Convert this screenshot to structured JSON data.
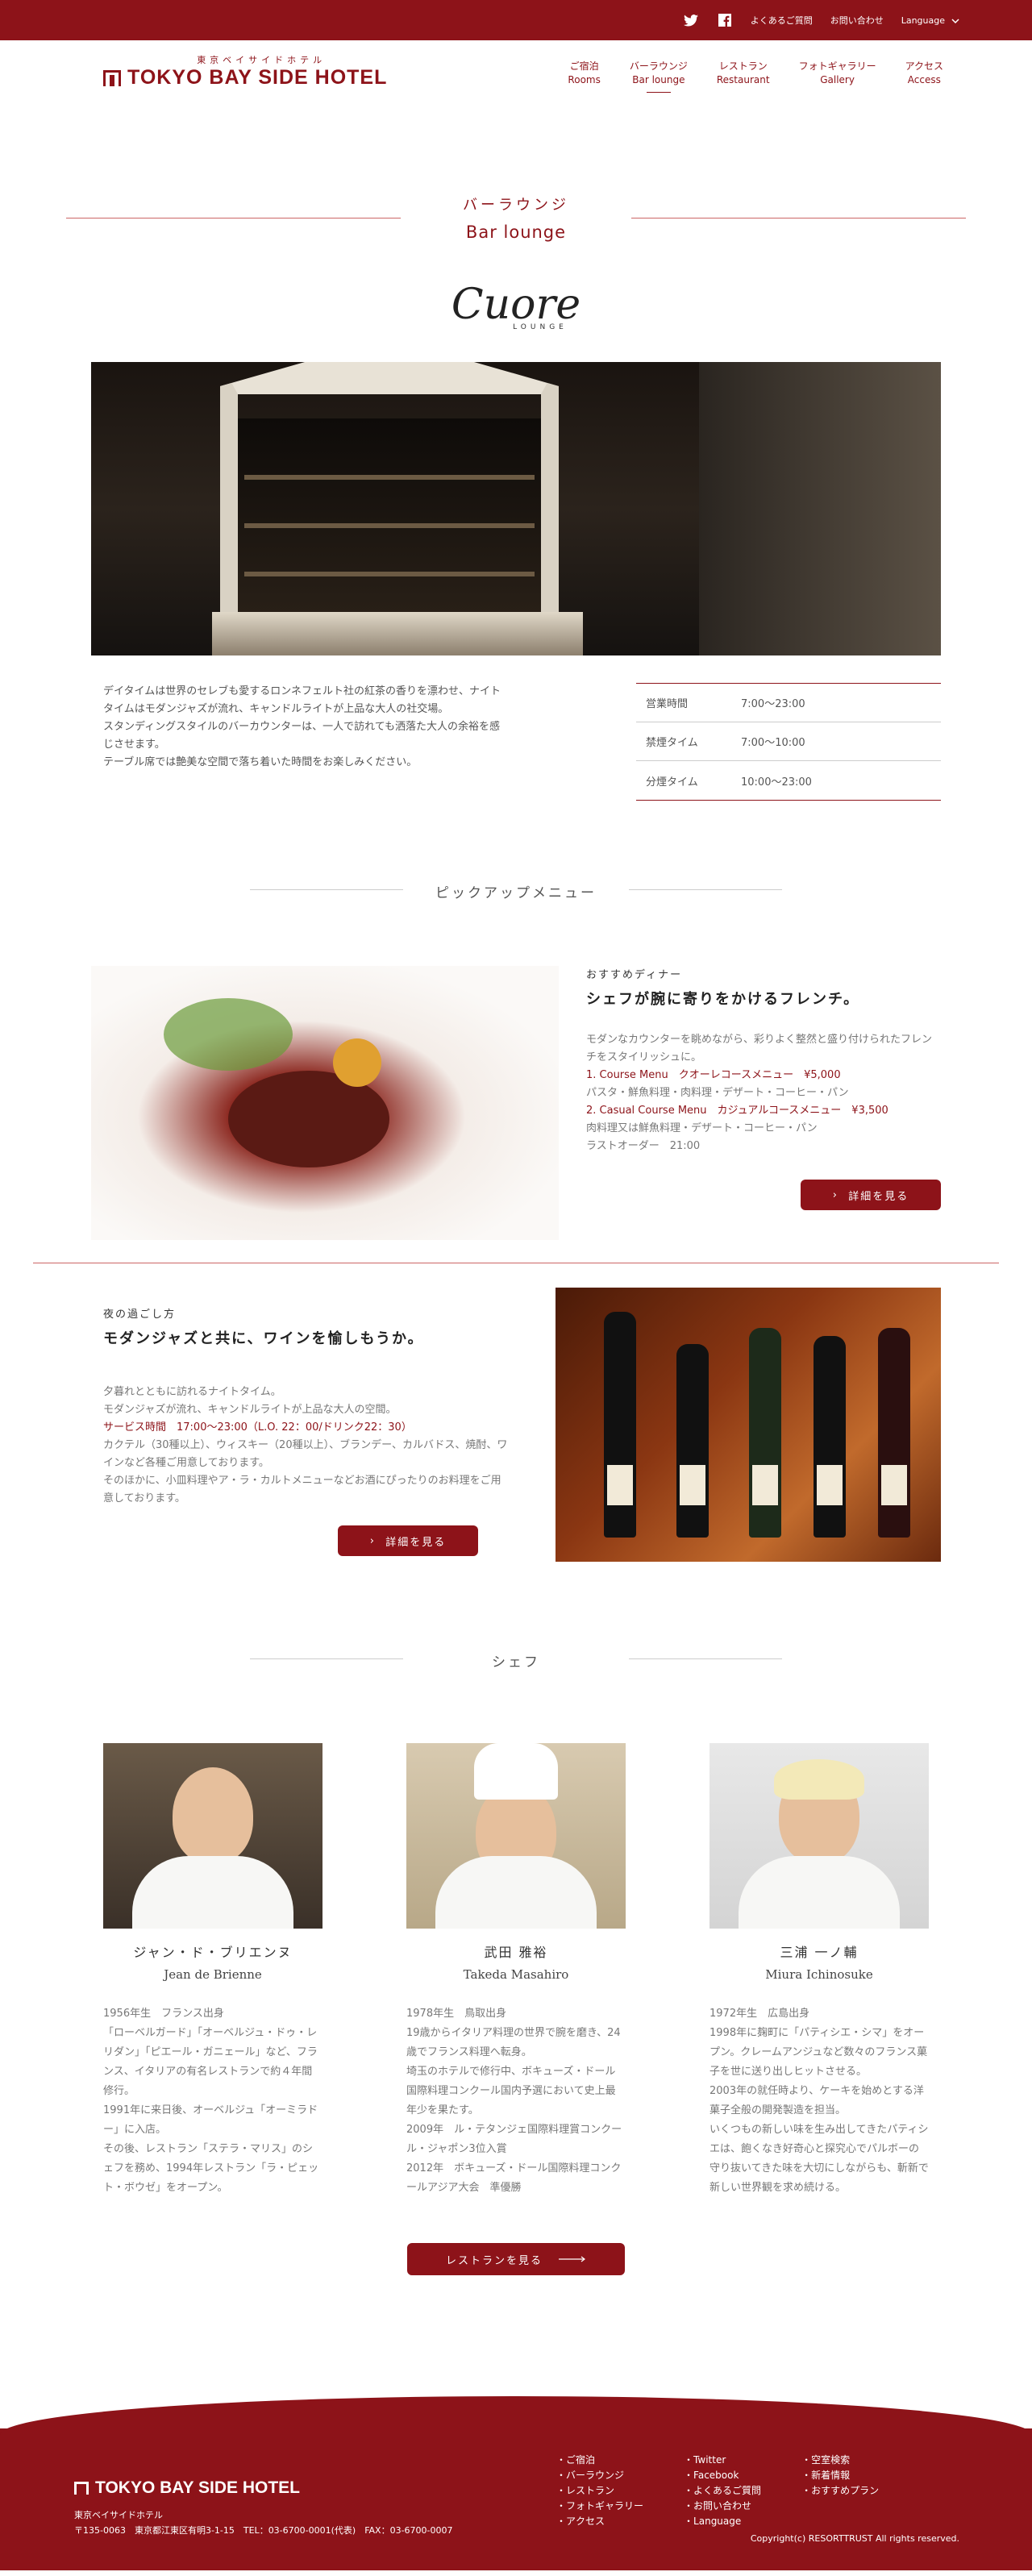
{
  "topbar": {
    "twitter_icon": "twitter-icon",
    "facebook_icon": "facebook-icon",
    "faq": "よくあるご質問",
    "contact": "お問い合わせ",
    "language": "Language"
  },
  "logo": {
    "jp": "東京ベイサイドホテル",
    "en": "TOKYO BAY SIDE HOTEL"
  },
  "nav": [
    {
      "jp": "ご宿泊",
      "en": "Rooms"
    },
    {
      "jp": "バーラウンジ",
      "en": "Bar lounge"
    },
    {
      "jp": "レストラン",
      "en": "Restaurant"
    },
    {
      "jp": "フォトギャラリー",
      "en": "Gallery"
    },
    {
      "jp": "アクセス",
      "en": "Access"
    }
  ],
  "section": {
    "jp": "バーラウンジ",
    "en": "Bar lounge"
  },
  "brand": {
    "name": "Cuore",
    "sub": "LOUNGE"
  },
  "intro": [
    "デイタイムは世界のセレブも愛するロンネフェルト社の紅茶の香りを漂わせ、ナイトタイムはモダンジャズが流れ、キャンドルライトが上品な大人の社交場。",
    "スタンディングスタイルのバーカウンターは、一人で訪れても洒落た大人の余裕を感じさせます。",
    "テーブル席では艶美な空間で落ち着いた時間をお楽しみください。"
  ],
  "hours": [
    {
      "label": "営業時間",
      "value": "7:00〜23:00"
    },
    {
      "label": "禁煙タイム",
      "value": "7:00〜10:00"
    },
    {
      "label": "分煙タイム",
      "value": "10:00〜23:00"
    }
  ],
  "pickup_title": "ピックアップメニュー",
  "dinner": {
    "kicker": "おすすめディナー",
    "headline": "シェフが腕に寄りをかけるフレンチ。",
    "lines": [
      "モダンなカウンターを眺めながら、彩りよく整然と盛り付けられたフレンチをスタイリッシュに。"
    ],
    "course1": "1. Course Menu　クオーレコースメニュー　¥5,000",
    "course1_desc": "パスタ・鮮魚料理・肉料理・デザート・コーヒー・パン",
    "course2": "2. Casual Course Menu　カジュアルコースメニュー　¥3,500",
    "course2_desc": "肉料理又は鮮魚料理・デザート・コーヒー・パン",
    "last_order": "ラストオーダー　21:00",
    "button": "詳細を見る"
  },
  "night": {
    "kicker": "夜の過ごし方",
    "headline": "モダンジャズと共に、ワインを愉しもうか。",
    "lines": [
      "夕暮れとともに訪れるナイトタイム。",
      "モダンジャズが流れ、キャンドルライトが上品な大人の空間。"
    ],
    "service": "サービス時間　17:00〜23:00（L.O. 22：00/ドリンク22：30）",
    "lines2": [
      "カクテル（30種以上）、ウィスキー（20種以上）、ブランデー、カルバドス、焼酎、ワインなど各種ご用意しております。",
      "そのほかに、小皿料理やア・ラ・カルトメニューなどお酒にぴったりのお料理をご用意しております。"
    ],
    "button": "詳細を見る"
  },
  "chef_title": "シェフ",
  "chefs": [
    {
      "jp": "ジャン・ド・ブリエンヌ",
      "en": "Jean de Brienne",
      "bio": "1956年生　フランス出身\n「ローベルガード」「オーベルジュ・ドゥ・レリダン」「ピエール・ガニェール」など、フランス、イタリアの有名レストランで約４年間修行。\n1991年に来日後、オーベルジュ「オーミラドー」に入店。\nその後、レストラン「ステラ・マリス」のシェフを務め、1994年レストラン「ラ・ピェット・ボウゼ」をオープン。"
    },
    {
      "jp": "武田 雅裕",
      "en": "Takeda Masahiro",
      "bio": "1978年生　鳥取出身\n19歳からイタリア料理の世界で腕を磨き、24歳でフランス料理へ転身。\n埼玉のホテルで修行中、ボキューズ・ドール国際料理コンクール国内予選において史上最年少を果たす。\n2009年　ル・テタンジェ国際料理賞コンクール・ジャポン3位入賞\n2012年　ボキューズ・ドール国際料理コンクールアジア大会　準優勝"
    },
    {
      "jp": "三浦 一ノ輔",
      "en": "Miura Ichinosuke",
      "bio": "1972年生　広島出身\n1998年に麹町に「パティシエ・シマ」をオープン。クレームアンジュなど数々のフランス菓子を世に送り出しヒットさせる。\n2003年の就任時より、ケーキを始めとする洋菓子全般の開発製造を担当。\nいくつもの新しい味を生み出してきたパティシエは、飽くなき好奇心と探究心でパルボーの守り抜いてきた味を大切にしながらも、斬新で新しい世界観を求め続ける。"
    }
  ],
  "restaurant_button": "レストランを見る",
  "footer": {
    "logo": "TOKYO BAY SIDE HOTEL",
    "name": "東京ベイサイドホテル",
    "address": "〒135-0063　東京都江東区有明3-1-15　TEL：03-6700-0001(代表)　FAX：03-6700-0007",
    "col1": [
      "ご宿泊",
      "バーラウンジ",
      "レストラン",
      "フォトギャラリー",
      "アクセス"
    ],
    "col2": [
      "Twitter",
      "Facebook",
      "よくあるご質問",
      "お問い合わせ",
      "Language"
    ],
    "col3": [
      "空室検索",
      "新着情報",
      "おすすめプラン"
    ],
    "copyright": "Copyright(c) RESORTTRUST All rights reserved."
  }
}
